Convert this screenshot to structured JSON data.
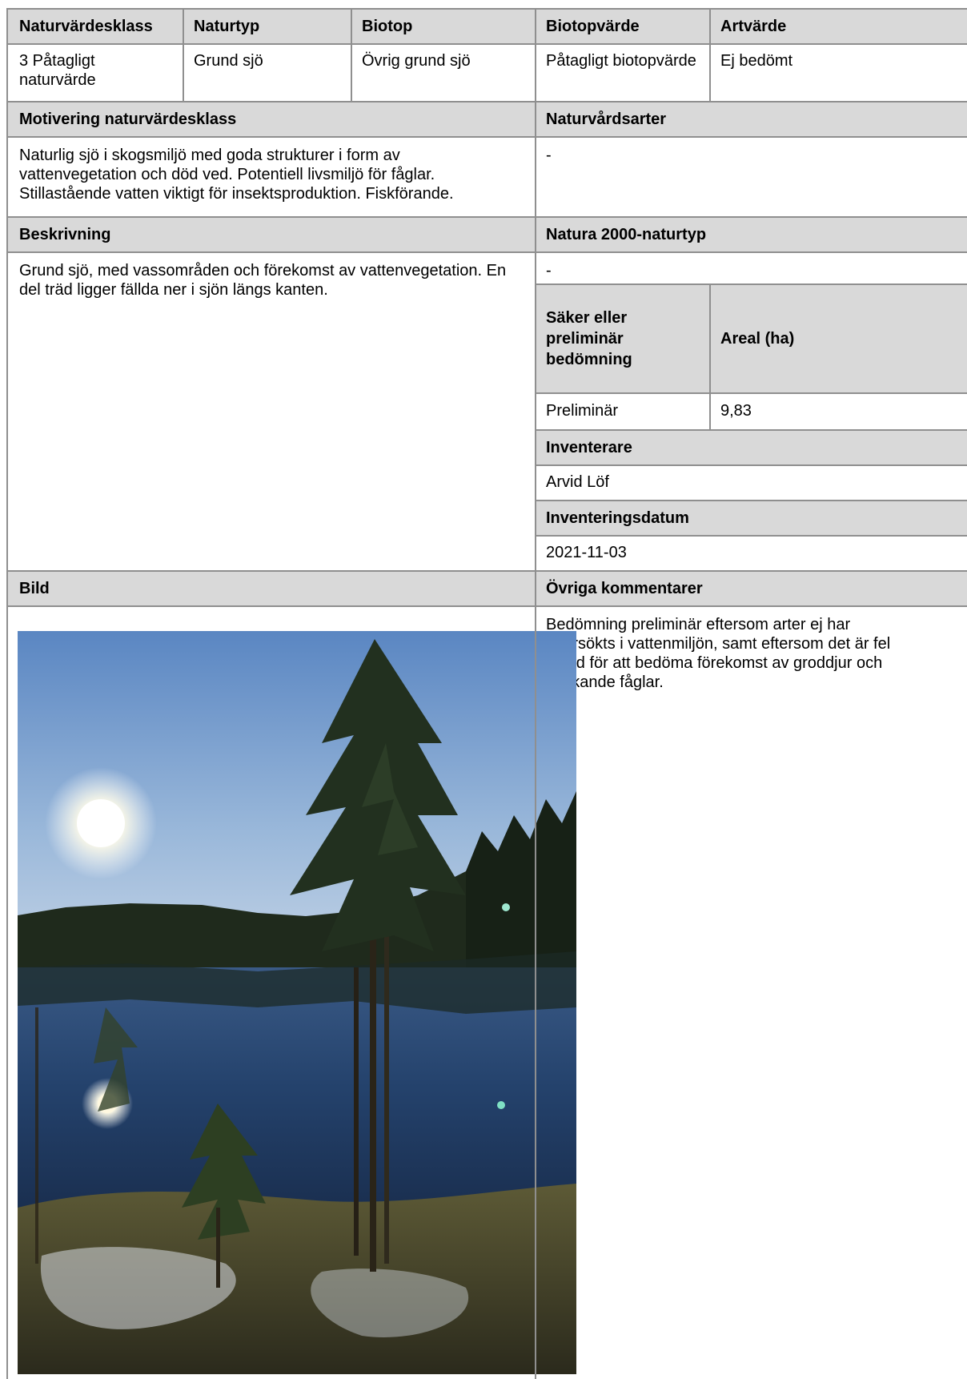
{
  "table": {
    "headers": {
      "naturvardesklass": "Naturvärdesklass",
      "naturtyp": "Naturtyp",
      "biotop": "Biotop",
      "biotopvarde": "Biotopvärde",
      "artvarde": "Artvärde"
    },
    "row1": {
      "naturvardesklass": "3 Påtagligt naturvärde",
      "naturtyp": "Grund sjö",
      "biotop": "Övrig grund sjö",
      "biotopvarde": "Påtagligt biotopvärde",
      "artvarde": "Ej bedömt"
    },
    "motivering": {
      "label": "Motivering naturvärdesklass",
      "text": "Naturlig sjö i skogsmiljö med goda strukturer i form av vattenvegetation och död ved. Potentiell livsmiljö för fåglar. Stillastående vatten viktigt för insektsproduktion. Fiskförande."
    },
    "naturvardsarter": {
      "label": "Naturvårdsarter",
      "value": "-"
    },
    "beskrivning": {
      "label": "Beskrivning",
      "text": "Grund sjö, med vassområden och förekomst av vattenvegetation. En del träd ligger fällda ner i sjön längs kanten."
    },
    "natura2000": {
      "label": "Natura 2000-naturtyp",
      "value": "-"
    },
    "bedomning": {
      "label": "Säker eller preliminär bedömning",
      "value": "Preliminär"
    },
    "areal": {
      "label": "Areal (ha)",
      "value": "9,83"
    },
    "inventerare": {
      "label": "Inventerare",
      "value": "Arvid Löf"
    },
    "inventeringsdatum": {
      "label": "Inventeringsdatum",
      "value": "2021-11-03"
    },
    "bild": {
      "label": "Bild"
    },
    "ovriga": {
      "label": "Övriga kommentarer",
      "text": "Bedömning preliminär eftersom arter ej har eftersökts i vattenmiljön, samt eftersom det är fel årstid för att bedöma förekomst av groddjur och häckande fåglar."
    }
  },
  "colors": {
    "header_bg": "#d9d9d9",
    "border": "#8f8f8f"
  }
}
